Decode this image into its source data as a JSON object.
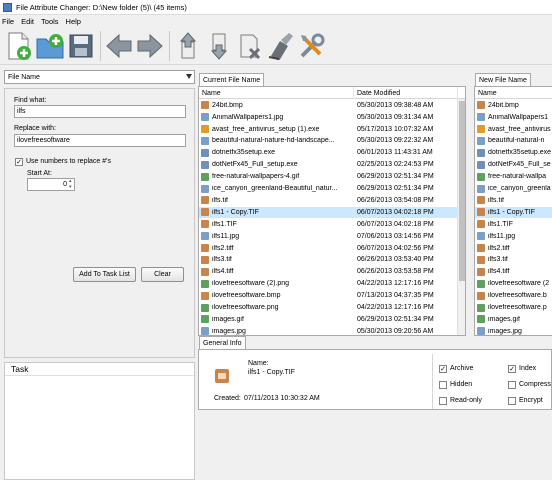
{
  "window": {
    "title": "File Attribute Changer: D:\\New folder (5)\\ (45 items)"
  },
  "menu": [
    "File",
    "Edit",
    "Tools",
    "Help"
  ],
  "toolbar": {
    "buttons": [
      "add-file-icon",
      "add-folder-icon",
      "save-icon",
      "back-arrow-icon",
      "forward-arrow-icon",
      "move-up-icon",
      "move-down-icon",
      "remove-icon",
      "clear-icon",
      "settings-tools-icon"
    ]
  },
  "left_panel": {
    "mode_select": "File Name",
    "find_label": "Find what:",
    "find_value": "ilfs",
    "replace_label": "Replace with:",
    "replace_value": "ilovefreesoftware",
    "use_numbers_label": "Use numbers to replace #'s",
    "use_numbers_checked": true,
    "start_at_label": "Start At:",
    "start_at_value": "0",
    "add_task_button": "Add To Task List",
    "clear_button": "Clear",
    "task_header": "Task"
  },
  "current": {
    "tab": "Current File Name",
    "col_name": "Name",
    "col_date": "Date Modified",
    "rows": [
      {
        "name": "24bit.bmp",
        "date": "05/30/2013 09:38:48 AM",
        "icon": "bmp-icon",
        "color": "#c9844a"
      },
      {
        "name": "AnimalWallpapers1.jpg",
        "date": "05/30/2013 09:31:34 AM",
        "icon": "jpg-icon",
        "color": "#7aa0c8"
      },
      {
        "name": "avast_free_antivirus_setup (1).exe",
        "date": "05/17/2013 10:07:32 AM",
        "icon": "exe-icon",
        "color": "#e39a2b"
      },
      {
        "name": "beautiful-natural-nature-hd-landscape...",
        "date": "05/30/2013 09:22:32 AM",
        "icon": "jpg-icon",
        "color": "#7aa0c8"
      },
      {
        "name": "dotnetfx35setup.exe",
        "date": "06/01/2013 11:43:31 AM",
        "icon": "exe-icon",
        "color": "#6f8fbf"
      },
      {
        "name": "dotNetFx45_Full_setup.exe",
        "date": "02/25/2013 02:24:53 PM",
        "icon": "exe-icon",
        "color": "#6f8fbf"
      },
      {
        "name": "free-natural-wallpapers-4.gif",
        "date": "06/29/2013 02:51:34 PM",
        "icon": "gif-icon",
        "color": "#5f9f5f"
      },
      {
        "name": "ice_canyon_greenland-Beautiful_natur...",
        "date": "06/29/2013 02:51:34 PM",
        "icon": "jpg-icon",
        "color": "#7aa0c8"
      },
      {
        "name": "ilfs.tif",
        "date": "06/26/2013 03:54:08 PM",
        "icon": "tif-icon",
        "color": "#c9844a"
      },
      {
        "name": "ilfs1 - Copy.TIF",
        "date": "06/07/2013 04:02:18 PM",
        "icon": "tif-icon",
        "color": "#c9844a"
      },
      {
        "name": "ilfs1.TIF",
        "date": "06/07/2013 04:02:18 PM",
        "icon": "tif-icon",
        "color": "#c9844a"
      },
      {
        "name": "ilfs11.jpg",
        "date": "07/06/2013 03:14:56 PM",
        "icon": "jpg-icon",
        "color": "#7aa0c8"
      },
      {
        "name": "ilfs2.tiff",
        "date": "06/07/2013 04:02:56 PM",
        "icon": "tif-icon",
        "color": "#c9844a"
      },
      {
        "name": "ilfs3.tif",
        "date": "06/26/2013 03:53:40 PM",
        "icon": "tif-icon",
        "color": "#c9844a"
      },
      {
        "name": "ilfs4.tiff",
        "date": "06/26/2013 03:53:58 PM",
        "icon": "tif-icon",
        "color": "#c9844a"
      },
      {
        "name": "ilovefreesoftware (2).png",
        "date": "04/22/2013 12:17:16 PM",
        "icon": "png-icon",
        "color": "#5f9f5f"
      },
      {
        "name": "ilovefreesoftware.bmp",
        "date": "07/13/2013 04:37:35 PM",
        "icon": "bmp-icon",
        "color": "#c9844a"
      },
      {
        "name": "ilovefreesoftware.png",
        "date": "04/22/2013 12:17:16 PM",
        "icon": "png-icon",
        "color": "#5f9f5f"
      },
      {
        "name": "images.gif",
        "date": "06/29/2013 02:51:34 PM",
        "icon": "gif-icon",
        "color": "#5f9f5f"
      },
      {
        "name": "images.jpg",
        "date": "05/30/2013 09:20:56 AM",
        "icon": "jpg-icon",
        "color": "#7aa0c8"
      }
    ],
    "selected_index": 9
  },
  "new": {
    "tab": "New File Name",
    "col_name": "Name",
    "rows": [
      "24bit.bmp",
      "AnimalWallpapers1",
      "avast_free_antivirus",
      "beautiful-natural-n",
      "dotnetfx35setup.exe",
      "dotNetFx45_Full_se",
      "free-natural-wallpa",
      "ice_canyon_greenla",
      "ilfs.tif",
      "ilfs1 - Copy.TIF",
      "ilfs1.TIF",
      "ilfs11.jpg",
      "ilfs2.tiff",
      "ilfs3.tif",
      "ilfs4.tiff",
      "ilovefreesoftware (2",
      "ilovefreesoftware.b",
      "ilovefreesoftware.p",
      "images.gif",
      "images.jpg"
    ],
    "selected_index": 9
  },
  "general_info": {
    "tab": "General Info",
    "name_label": "Name:",
    "name_value": "ilfs1 - Copy.TIF",
    "created_label": "Created:",
    "created_value": "07/11/2013 10:30:32 AM",
    "attrs": [
      {
        "label": "Archive",
        "checked": true
      },
      {
        "label": "Hidden",
        "checked": false
      },
      {
        "label": "Read-only",
        "checked": false
      },
      {
        "label": "Index",
        "checked": true
      },
      {
        "label": "Compress",
        "checked": false
      },
      {
        "label": "Encrypt",
        "checked": false
      }
    ]
  }
}
